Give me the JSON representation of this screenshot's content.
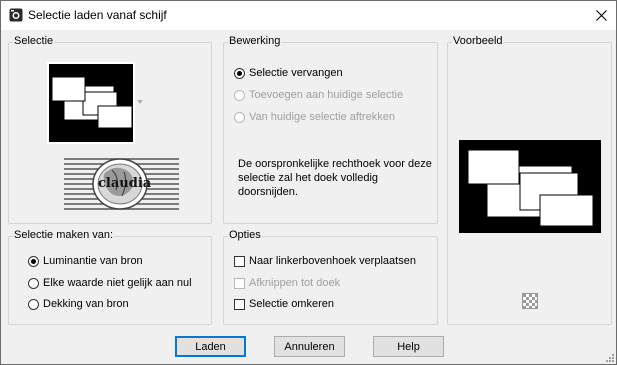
{
  "window": {
    "title": "Selectie laden vanaf schijf"
  },
  "selectie": {
    "title": "Selectie",
    "watermark_text": "claudia"
  },
  "bewerking": {
    "title": "Bewerking",
    "options": [
      {
        "label": "Selectie vervangen",
        "checked": true,
        "enabled": true
      },
      {
        "label": "Toevoegen aan huidige selectie",
        "checked": false,
        "enabled": false
      },
      {
        "label": "Van huidige selectie aftrekken",
        "checked": false,
        "enabled": false
      }
    ],
    "description": "De oorspronkelijke rechthoek voor deze selectie zal het doek volledig doorsnijden."
  },
  "voorbeeld": {
    "title": "Voorbeeld"
  },
  "selectie_maken": {
    "title": "Selectie maken van:",
    "options": [
      {
        "label": "Luminantie van bron",
        "checked": true
      },
      {
        "label": "Elke waarde niet gelijk aan nul",
        "checked": false
      },
      {
        "label": "Dekking van bron",
        "checked": false
      }
    ]
  },
  "opties": {
    "title": "Opties",
    "options": [
      {
        "label": "Naar linkerbovenhoek verplaatsen",
        "checked": false,
        "enabled": true
      },
      {
        "label": "Afknippen tot doek",
        "checked": false,
        "enabled": false
      },
      {
        "label": "Selectie omkeren",
        "checked": false,
        "enabled": true
      }
    ]
  },
  "buttons": {
    "load": "Laden",
    "cancel": "Annuleren",
    "help": "Help"
  },
  "colors": {
    "accent": "#0078d7",
    "panel": "#f0f0f0",
    "border": "#d5d5d5"
  }
}
